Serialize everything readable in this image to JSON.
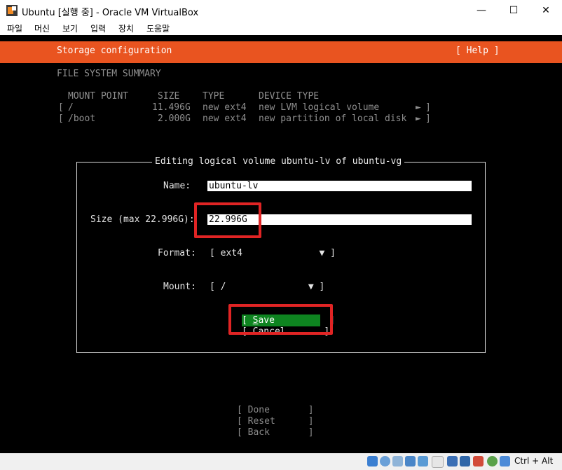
{
  "window": {
    "title": "Ubuntu [실행 중] - Oracle VM VirtualBox",
    "controls": {
      "minimize": "—",
      "maximize": "☐",
      "close": "✕"
    }
  },
  "menu": [
    "파일",
    "머신",
    "보기",
    "입력",
    "장치",
    "도움말"
  ],
  "header": {
    "title": "Storage configuration",
    "help": "[ Help ]"
  },
  "summary": {
    "heading": "FILE SYSTEM SUMMARY",
    "columns": [
      "MOUNT POINT",
      "SIZE",
      "TYPE",
      "DEVICE TYPE"
    ],
    "rows": [
      {
        "open": "[",
        "mount": "/",
        "size": "11.496G",
        "type": "new ext4",
        "device": "new LVM logical volume",
        "arrow": "►",
        "close": "]"
      },
      {
        "open": "[",
        "mount": "/boot",
        "size": "2.000G",
        "type": "new ext4",
        "device": "new partition of local disk",
        "arrow": "►",
        "close": "]"
      }
    ]
  },
  "dialog": {
    "title": "Editing logical volume ubuntu-lv of ubuntu-vg",
    "name_label": "Name:",
    "name_value": "ubuntu-lv",
    "size_label": "Size (max 22.996G):",
    "size_value": "22.996G",
    "format_label": "Format:",
    "format_value": "[ ext4              ▼ ]",
    "mount_label": "Mount:",
    "mount_value": "[ /               ▼ ]",
    "save_prefix": "[ ",
    "save_hotkey": "S",
    "save_rest": "ave          ]",
    "cancel_label": "[ Cancel       ]"
  },
  "footer_buttons": [
    "[ Done       ]",
    "[ Reset      ]",
    "[ Back       ]"
  ],
  "statusbar": {
    "hostkey": "Ctrl + Alt"
  },
  "colors": {
    "accent": "#e95420",
    "save_button": "#0e8420",
    "highlight_box": "#e02424"
  }
}
